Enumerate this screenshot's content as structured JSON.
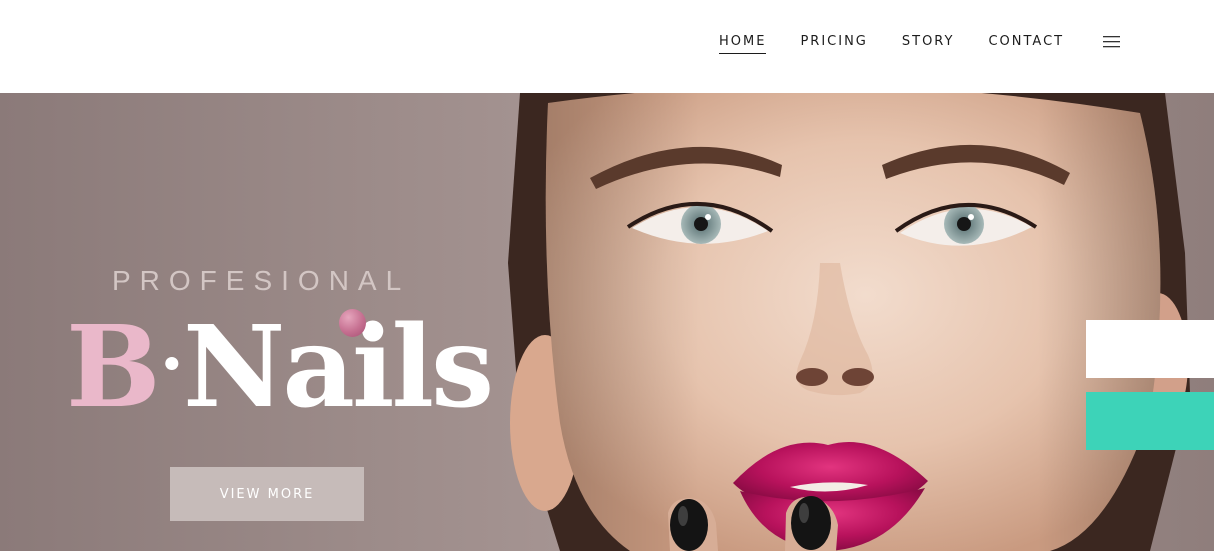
{
  "nav": {
    "items": [
      {
        "label": "HOME",
        "active": true
      },
      {
        "label": "PRICING",
        "active": false
      },
      {
        "label": "STORY",
        "active": false
      },
      {
        "label": "CONTACT",
        "active": false
      }
    ],
    "menu_icon": "hamburger-icon"
  },
  "hero": {
    "subtitle": "PROFESIONAL",
    "title_initial": "B",
    "title_separator": "·",
    "title_rest": "Nails",
    "cta_label": "VIEW MORE",
    "photo": "woman-face-portrait"
  },
  "colors": {
    "title_initial": "#eab8ca",
    "cta_background": "#c6bbb9",
    "accent_teal": "#3dd3b8",
    "nail_drop": "#c56f90"
  }
}
